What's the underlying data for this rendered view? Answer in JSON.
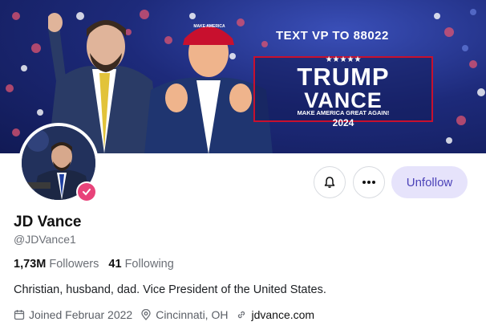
{
  "banner": {
    "text_vp": "TEXT VP TO 88022",
    "stars": "★★★★★",
    "sign_line1": "TRUMP",
    "sign_line2": "VANCE",
    "sign_slogan": "MAKE AMERICA GREAT AGAIN!",
    "sign_year": "2024",
    "hat_text": "MAKE AMERICA"
  },
  "profile": {
    "name": "JD Vance",
    "handle": "@JDVance1",
    "followers_count": "1,73M",
    "followers_label": "Followers",
    "following_count": "41",
    "following_label": "Following",
    "bio": "Christian, husband, dad. Vice President of the United States.",
    "joined": "Joined Februar 2022",
    "location": "Cincinnati, OH",
    "website": "jdvance.com"
  },
  "actions": {
    "notify_icon": "bell-icon",
    "more_icon": "more-horizontal-icon",
    "unfollow_label": "Unfollow"
  },
  "colors": {
    "accent": "#4b42b8",
    "accent_bg": "#e6e3fb",
    "verified": "#e8437a",
    "sign_border": "#c8102e"
  }
}
